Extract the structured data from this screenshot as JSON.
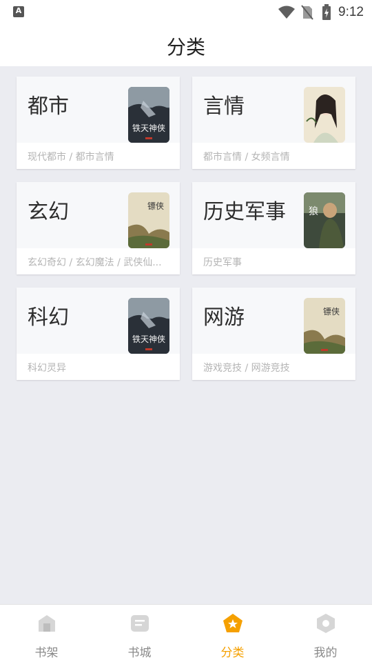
{
  "status_bar": {
    "time": "9:12",
    "left_icon_letter": "A"
  },
  "header": {
    "title": "分类"
  },
  "categories": [
    {
      "name": "都市",
      "sub": "现代都市 / 都市言情",
      "cover_text": "铁天神侠"
    },
    {
      "name": "言情",
      "sub": "都市言情 / 女频言情",
      "cover_text": ""
    },
    {
      "name": "玄幻",
      "sub": "玄幻奇幻 / 玄幻魔法 / 武侠仙...",
      "cover_text": "镖侠"
    },
    {
      "name": "历史军事",
      "sub": "历史军事",
      "cover_text": "狼"
    },
    {
      "name": "科幻",
      "sub": "科幻灵异",
      "cover_text": "铁天神侠"
    },
    {
      "name": "网游",
      "sub": "游戏竞技 / 网游竞技",
      "cover_text": "镖侠"
    }
  ],
  "nav": [
    {
      "label": "书架",
      "icon": "bookshelf-icon"
    },
    {
      "label": "书城",
      "icon": "bookstore-icon"
    },
    {
      "label": "分类",
      "icon": "category-icon",
      "active": true
    },
    {
      "label": "我的",
      "icon": "profile-icon"
    }
  ],
  "colors": {
    "accent": "#f5a000",
    "background": "#ebecf1"
  }
}
